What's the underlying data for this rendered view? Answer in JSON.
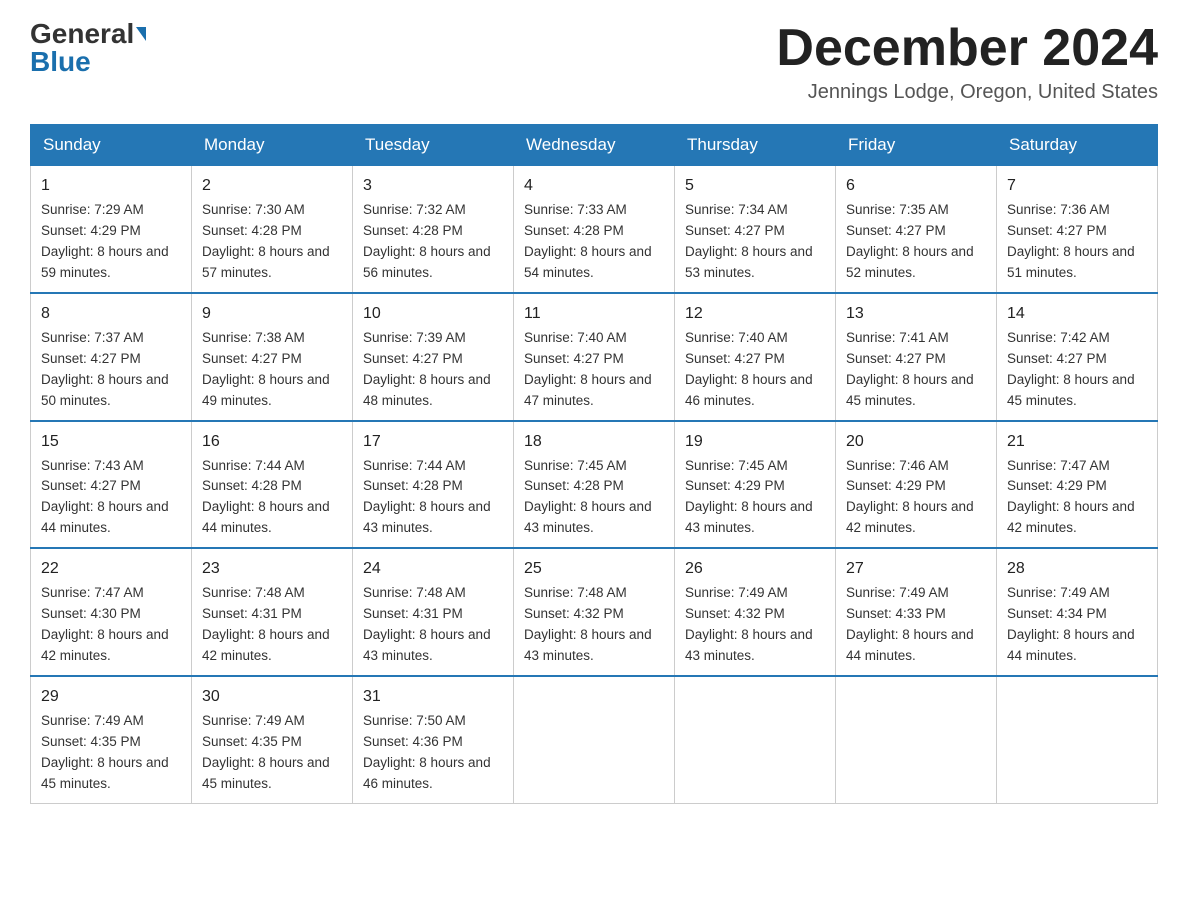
{
  "header": {
    "logo_general": "General",
    "logo_blue": "Blue",
    "title": "December 2024",
    "location": "Jennings Lodge, Oregon, United States"
  },
  "weekdays": [
    "Sunday",
    "Monday",
    "Tuesday",
    "Wednesday",
    "Thursday",
    "Friday",
    "Saturday"
  ],
  "weeks": [
    [
      {
        "day": "1",
        "sunrise": "Sunrise: 7:29 AM",
        "sunset": "Sunset: 4:29 PM",
        "daylight": "Daylight: 8 hours and 59 minutes."
      },
      {
        "day": "2",
        "sunrise": "Sunrise: 7:30 AM",
        "sunset": "Sunset: 4:28 PM",
        "daylight": "Daylight: 8 hours and 57 minutes."
      },
      {
        "day": "3",
        "sunrise": "Sunrise: 7:32 AM",
        "sunset": "Sunset: 4:28 PM",
        "daylight": "Daylight: 8 hours and 56 minutes."
      },
      {
        "day": "4",
        "sunrise": "Sunrise: 7:33 AM",
        "sunset": "Sunset: 4:28 PM",
        "daylight": "Daylight: 8 hours and 54 minutes."
      },
      {
        "day": "5",
        "sunrise": "Sunrise: 7:34 AM",
        "sunset": "Sunset: 4:27 PM",
        "daylight": "Daylight: 8 hours and 53 minutes."
      },
      {
        "day": "6",
        "sunrise": "Sunrise: 7:35 AM",
        "sunset": "Sunset: 4:27 PM",
        "daylight": "Daylight: 8 hours and 52 minutes."
      },
      {
        "day": "7",
        "sunrise": "Sunrise: 7:36 AM",
        "sunset": "Sunset: 4:27 PM",
        "daylight": "Daylight: 8 hours and 51 minutes."
      }
    ],
    [
      {
        "day": "8",
        "sunrise": "Sunrise: 7:37 AM",
        "sunset": "Sunset: 4:27 PM",
        "daylight": "Daylight: 8 hours and 50 minutes."
      },
      {
        "day": "9",
        "sunrise": "Sunrise: 7:38 AM",
        "sunset": "Sunset: 4:27 PM",
        "daylight": "Daylight: 8 hours and 49 minutes."
      },
      {
        "day": "10",
        "sunrise": "Sunrise: 7:39 AM",
        "sunset": "Sunset: 4:27 PM",
        "daylight": "Daylight: 8 hours and 48 minutes."
      },
      {
        "day": "11",
        "sunrise": "Sunrise: 7:40 AM",
        "sunset": "Sunset: 4:27 PM",
        "daylight": "Daylight: 8 hours and 47 minutes."
      },
      {
        "day": "12",
        "sunrise": "Sunrise: 7:40 AM",
        "sunset": "Sunset: 4:27 PM",
        "daylight": "Daylight: 8 hours and 46 minutes."
      },
      {
        "day": "13",
        "sunrise": "Sunrise: 7:41 AM",
        "sunset": "Sunset: 4:27 PM",
        "daylight": "Daylight: 8 hours and 45 minutes."
      },
      {
        "day": "14",
        "sunrise": "Sunrise: 7:42 AM",
        "sunset": "Sunset: 4:27 PM",
        "daylight": "Daylight: 8 hours and 45 minutes."
      }
    ],
    [
      {
        "day": "15",
        "sunrise": "Sunrise: 7:43 AM",
        "sunset": "Sunset: 4:27 PM",
        "daylight": "Daylight: 8 hours and 44 minutes."
      },
      {
        "day": "16",
        "sunrise": "Sunrise: 7:44 AM",
        "sunset": "Sunset: 4:28 PM",
        "daylight": "Daylight: 8 hours and 44 minutes."
      },
      {
        "day": "17",
        "sunrise": "Sunrise: 7:44 AM",
        "sunset": "Sunset: 4:28 PM",
        "daylight": "Daylight: 8 hours and 43 minutes."
      },
      {
        "day": "18",
        "sunrise": "Sunrise: 7:45 AM",
        "sunset": "Sunset: 4:28 PM",
        "daylight": "Daylight: 8 hours and 43 minutes."
      },
      {
        "day": "19",
        "sunrise": "Sunrise: 7:45 AM",
        "sunset": "Sunset: 4:29 PM",
        "daylight": "Daylight: 8 hours and 43 minutes."
      },
      {
        "day": "20",
        "sunrise": "Sunrise: 7:46 AM",
        "sunset": "Sunset: 4:29 PM",
        "daylight": "Daylight: 8 hours and 42 minutes."
      },
      {
        "day": "21",
        "sunrise": "Sunrise: 7:47 AM",
        "sunset": "Sunset: 4:29 PM",
        "daylight": "Daylight: 8 hours and 42 minutes."
      }
    ],
    [
      {
        "day": "22",
        "sunrise": "Sunrise: 7:47 AM",
        "sunset": "Sunset: 4:30 PM",
        "daylight": "Daylight: 8 hours and 42 minutes."
      },
      {
        "day": "23",
        "sunrise": "Sunrise: 7:48 AM",
        "sunset": "Sunset: 4:31 PM",
        "daylight": "Daylight: 8 hours and 42 minutes."
      },
      {
        "day": "24",
        "sunrise": "Sunrise: 7:48 AM",
        "sunset": "Sunset: 4:31 PM",
        "daylight": "Daylight: 8 hours and 43 minutes."
      },
      {
        "day": "25",
        "sunrise": "Sunrise: 7:48 AM",
        "sunset": "Sunset: 4:32 PM",
        "daylight": "Daylight: 8 hours and 43 minutes."
      },
      {
        "day": "26",
        "sunrise": "Sunrise: 7:49 AM",
        "sunset": "Sunset: 4:32 PM",
        "daylight": "Daylight: 8 hours and 43 minutes."
      },
      {
        "day": "27",
        "sunrise": "Sunrise: 7:49 AM",
        "sunset": "Sunset: 4:33 PM",
        "daylight": "Daylight: 8 hours and 44 minutes."
      },
      {
        "day": "28",
        "sunrise": "Sunrise: 7:49 AM",
        "sunset": "Sunset: 4:34 PM",
        "daylight": "Daylight: 8 hours and 44 minutes."
      }
    ],
    [
      {
        "day": "29",
        "sunrise": "Sunrise: 7:49 AM",
        "sunset": "Sunset: 4:35 PM",
        "daylight": "Daylight: 8 hours and 45 minutes."
      },
      {
        "day": "30",
        "sunrise": "Sunrise: 7:49 AM",
        "sunset": "Sunset: 4:35 PM",
        "daylight": "Daylight: 8 hours and 45 minutes."
      },
      {
        "day": "31",
        "sunrise": "Sunrise: 7:50 AM",
        "sunset": "Sunset: 4:36 PM",
        "daylight": "Daylight: 8 hours and 46 minutes."
      },
      null,
      null,
      null,
      null
    ]
  ]
}
